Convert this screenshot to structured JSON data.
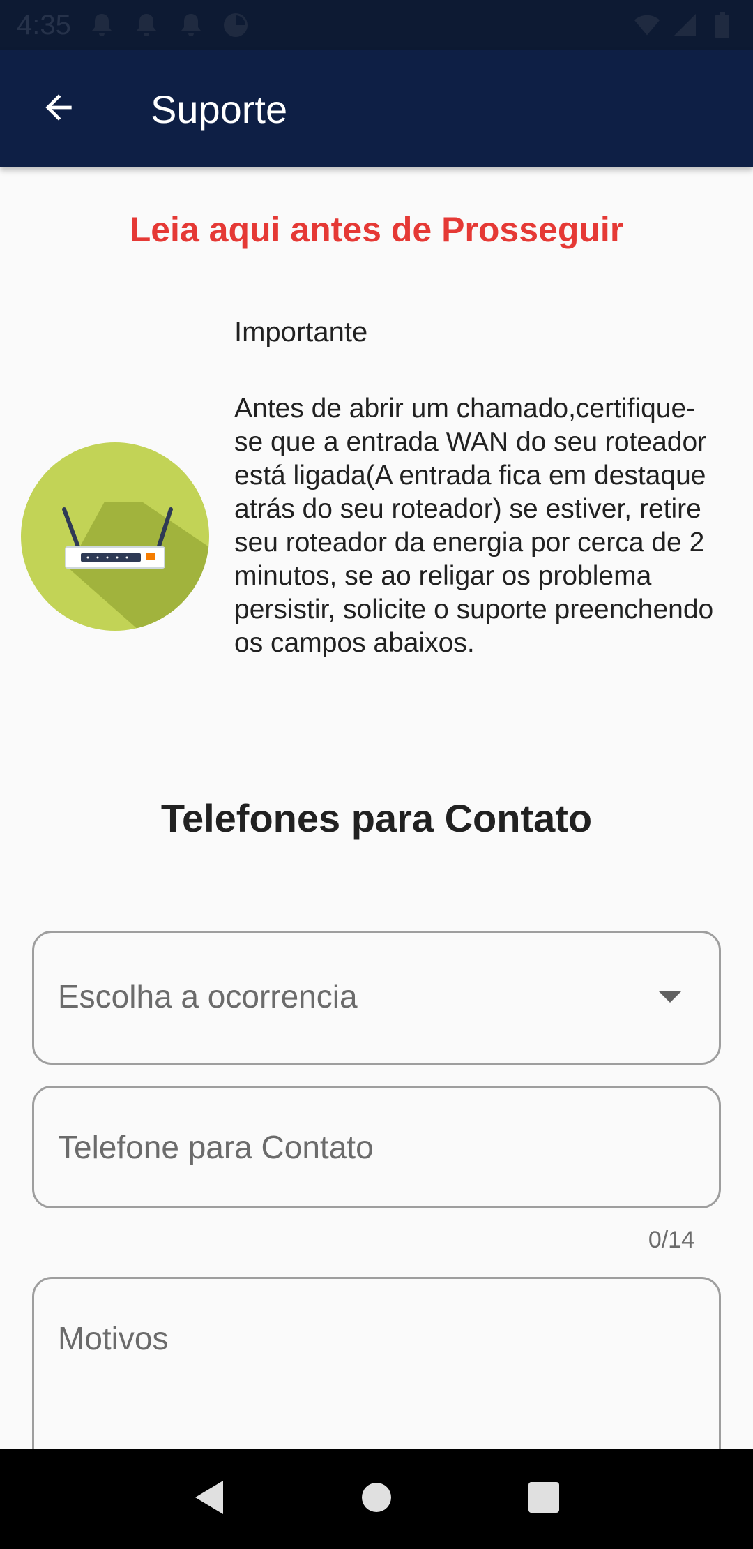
{
  "status_bar": {
    "time": "4:35",
    "icons": [
      "notification-icon",
      "notification-icon",
      "notification-icon",
      "sync-icon",
      "wifi-icon",
      "signal-icon",
      "battery-icon"
    ]
  },
  "app_bar": {
    "title": "Suporte",
    "back_icon": "arrow-back-icon",
    "background": "#0e1f45"
  },
  "warning": {
    "title": "Leia aqui antes de Prosseguir",
    "color": "#e53935"
  },
  "info": {
    "heading": "Importante",
    "body": "Antes de abrir um chamado,certifique-se que a entrada WAN do seu roteador está ligada(A entrada fica em destaque atrás do seu roteador) se estiver, retire seu roteador da energia por cerca de 2 minutos, se ao religar os problema persistir, solicite o suporte preenchendo os campos abaixos.",
    "illustration": "router-icon"
  },
  "contact": {
    "title": "Telefones para Contato"
  },
  "form": {
    "occurrence": {
      "placeholder": "Escolha a ocorrencia"
    },
    "phone": {
      "placeholder": "Telefone para Contato",
      "counter": "0/14"
    },
    "reasons": {
      "placeholder": "Motivos"
    }
  },
  "nav_bar": {
    "icons": [
      "back-triangle-icon",
      "home-circle-icon",
      "recents-square-icon"
    ]
  }
}
